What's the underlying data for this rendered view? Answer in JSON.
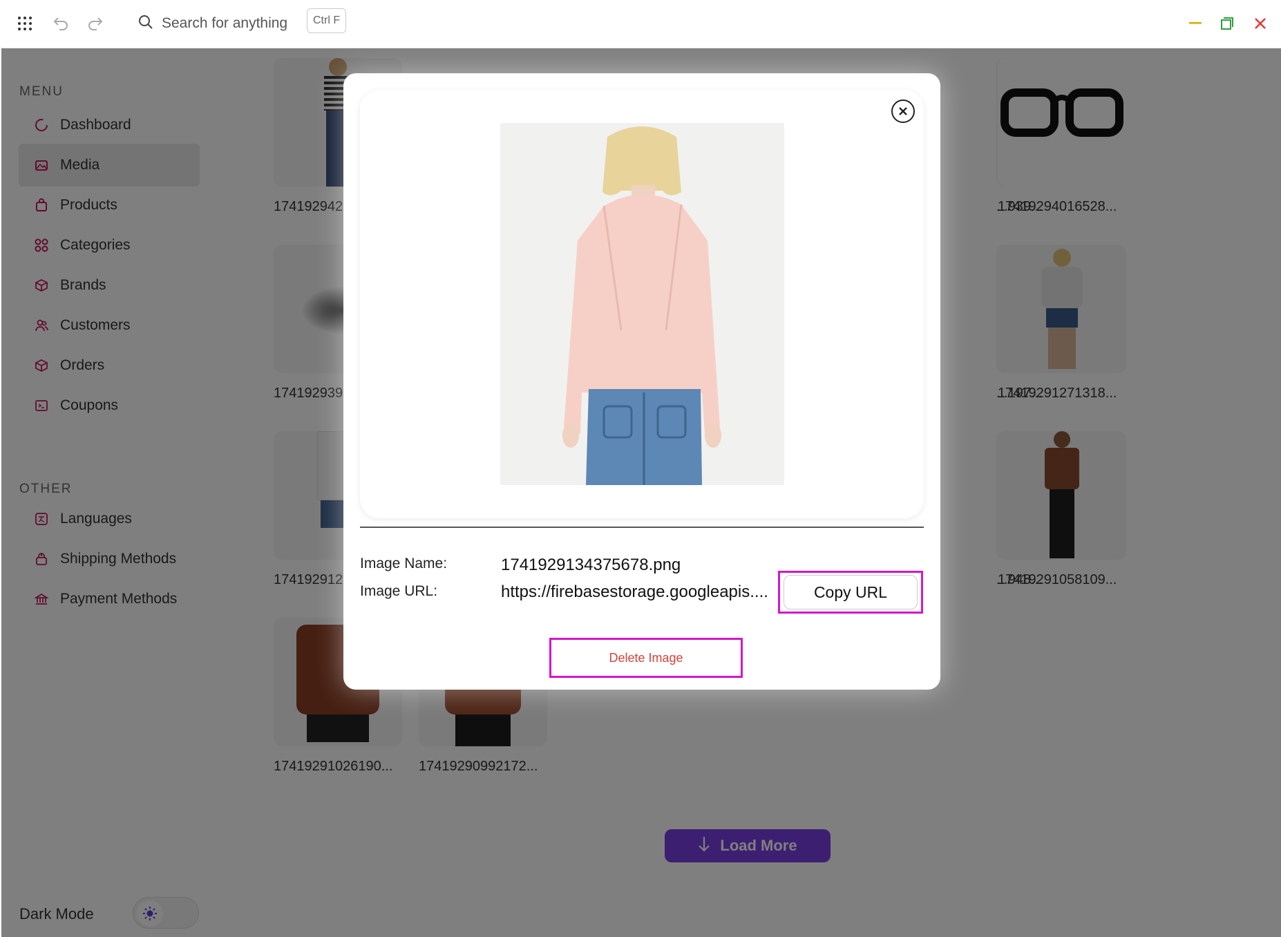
{
  "topbar": {
    "search_placeholder": "Search for anything",
    "shortcut": "Ctrl F",
    "icons": [
      "apps-grid-icon",
      "undo-icon",
      "redo-icon",
      "search-icon",
      "minimize-icon",
      "maximize-icon",
      "close-icon"
    ]
  },
  "sidebar": {
    "menu_title": "MENU",
    "menu_items": [
      {
        "label": "Dashboard",
        "icon": "dashboard-icon"
      },
      {
        "label": "Media",
        "icon": "media-icon",
        "active": true
      },
      {
        "label": "Products",
        "icon": "products-icon"
      },
      {
        "label": "Categories",
        "icon": "categories-icon"
      },
      {
        "label": "Brands",
        "icon": "brands-icon"
      },
      {
        "label": "Customers",
        "icon": "customers-icon"
      },
      {
        "label": "Orders",
        "icon": "orders-icon"
      },
      {
        "label": "Coupons",
        "icon": "coupons-icon"
      }
    ],
    "other_title": "OTHER",
    "other_items": [
      {
        "label": "Languages",
        "icon": "languages-icon"
      },
      {
        "label": "Shipping Methods",
        "icon": "shipping-icon"
      },
      {
        "label": "Payment Methods",
        "icon": "payment-icon"
      }
    ],
    "dark_mode_label": "Dark Mode",
    "accent_color": "#c2185b"
  },
  "media_grid": {
    "items": [
      {
        "label": "174192942"
      },
      {
        "label": "...939..."
      },
      {
        "label": "17419294016528..."
      },
      {
        "label": "174192939"
      },
      {
        "label": "...197..."
      },
      {
        "label": "17419291271318..."
      },
      {
        "label": "174192912"
      },
      {
        "label": "...948..."
      },
      {
        "label": "17419291058109..."
      },
      {
        "label": "17419291026190..."
      },
      {
        "label": "17419290992172..."
      }
    ],
    "load_more_label": "Load More",
    "load_more_color": "#7b3fe4"
  },
  "modal": {
    "image_name_label": "Image Name:",
    "image_name": "1741929134375678.png",
    "image_url_label": "Image URL:",
    "image_url": "https://firebasestorage.googleapis....",
    "copy_url_label": "Copy URL",
    "delete_label": "Delete Image",
    "highlight_color": "#d417c9"
  }
}
